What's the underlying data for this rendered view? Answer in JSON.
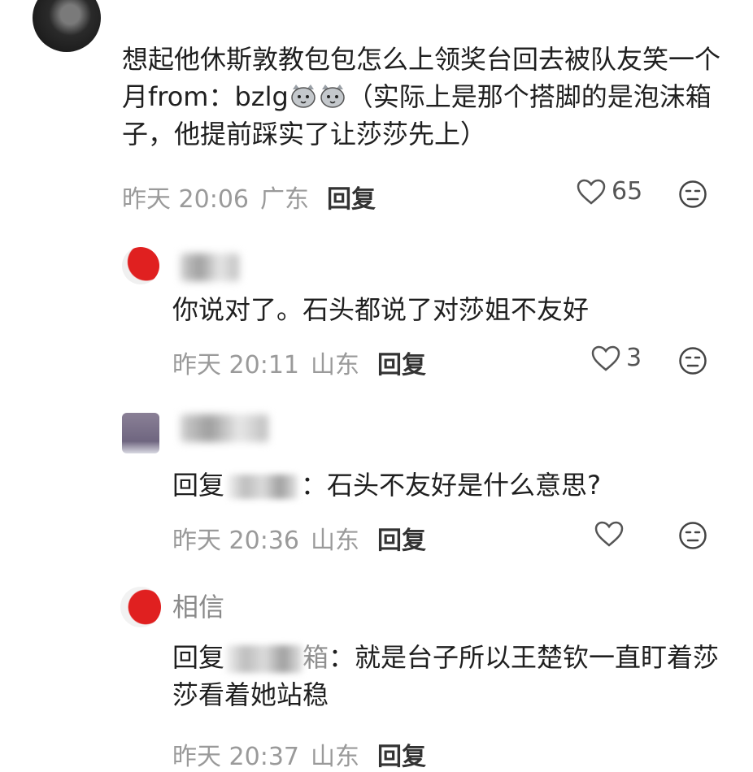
{
  "comments": [
    {
      "text_before": "想起他休斯敦教包包怎么上领奖台回去被队友笑一个月from：bzlg",
      "text_after": "（实际上是那个搭脚的是泡沫箱子，他提前踩实了让莎莎先上）",
      "time": "昨天 20:06",
      "location": "广东",
      "reply_label": "回复",
      "likes": "65"
    },
    {
      "text": "你说对了。石头都说了对莎姐不友好",
      "time": "昨天 20:11",
      "location": "山东",
      "reply_label": "回复",
      "likes": "3"
    },
    {
      "reply_prefix": "回复",
      "text": "：石头不友好是什么意思?",
      "time": "昨天 20:36",
      "location": "山东",
      "reply_label": "回复"
    },
    {
      "name": "相信",
      "reply_prefix": "回复",
      "reply_to_tail": "箱",
      "text": "：就是台子所以王楚钦一直盯着莎莎看着她站稳",
      "time": "昨天 20:37",
      "location": "山东",
      "reply_label": "回复"
    }
  ],
  "colors": {
    "text": "#1f1f1f",
    "meta": "#9a9a9a",
    "avatar_red": "#e02020"
  },
  "icons": {
    "like": "heart-outline-icon",
    "react": "neutral-face-icon",
    "emoji": "cat-face-emoji"
  }
}
